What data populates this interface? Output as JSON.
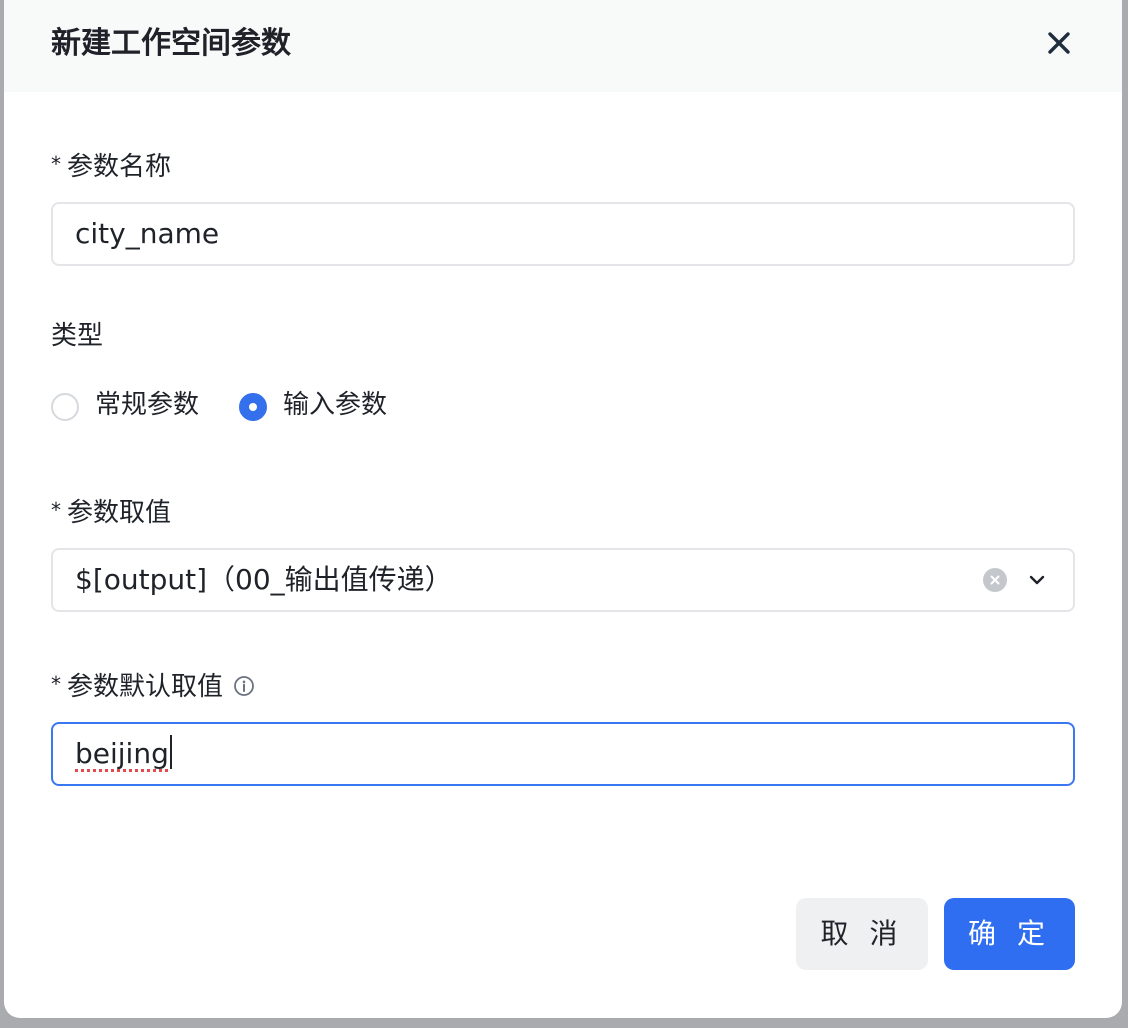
{
  "dialog": {
    "title": "新建工作空间参数"
  },
  "form": {
    "required_mark": "*",
    "param_name": {
      "label": "参数名称",
      "value": "city_name"
    },
    "type": {
      "label": "类型",
      "options": [
        {
          "label": "常规参数",
          "checked": false
        },
        {
          "label": "输入参数",
          "checked": true
        }
      ]
    },
    "param_value": {
      "label": "参数取值",
      "selected": "$[output]（00_输出值传递）"
    },
    "param_default": {
      "label": "参数默认取值",
      "value": "beijing"
    }
  },
  "buttons": {
    "cancel": "取 消",
    "ok": "确 定"
  },
  "colors": {
    "primary": "#2f6ef0",
    "radio_checked": "#3470ec",
    "focus_border": "#3a78f2"
  }
}
